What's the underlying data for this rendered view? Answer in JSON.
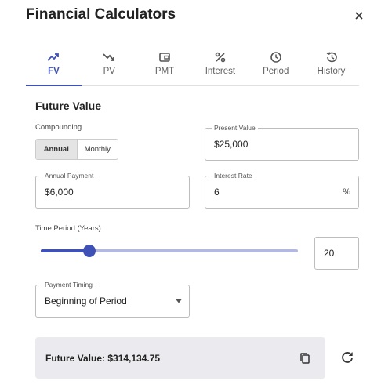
{
  "dialog": {
    "title": "Financial Calculators"
  },
  "tabs": [
    {
      "label": "FV",
      "icon": "trending-up-icon",
      "active": true
    },
    {
      "label": "PV",
      "icon": "trending-down-icon"
    },
    {
      "label": "PMT",
      "icon": "wallet-icon"
    },
    {
      "label": "Interest",
      "icon": "percent-icon"
    },
    {
      "label": "Period",
      "icon": "clock-icon"
    },
    {
      "label": "History",
      "icon": "history-icon"
    }
  ],
  "form": {
    "section_title": "Future Value",
    "compounding": {
      "label": "Compounding",
      "options": [
        "Annual",
        "Monthly"
      ],
      "selected": "Annual"
    },
    "present_value": {
      "label": "Present Value",
      "value": "$25,000"
    },
    "annual_payment": {
      "label": "Annual Payment",
      "value": "$6,000"
    },
    "interest_rate": {
      "label": "Interest Rate",
      "value": "6",
      "suffix": "%"
    },
    "time_period": {
      "label": "Time Period (Years)",
      "value": "20",
      "slider_fraction": 0.19
    },
    "payment_timing": {
      "label": "Payment Timing",
      "value": "Beginning of Period"
    }
  },
  "result": {
    "text": "Future Value: $314,134.75"
  },
  "colors": {
    "accent": "#3f51b5",
    "accent_light": "#b3b8e0",
    "result_bg": "#ebebef"
  }
}
